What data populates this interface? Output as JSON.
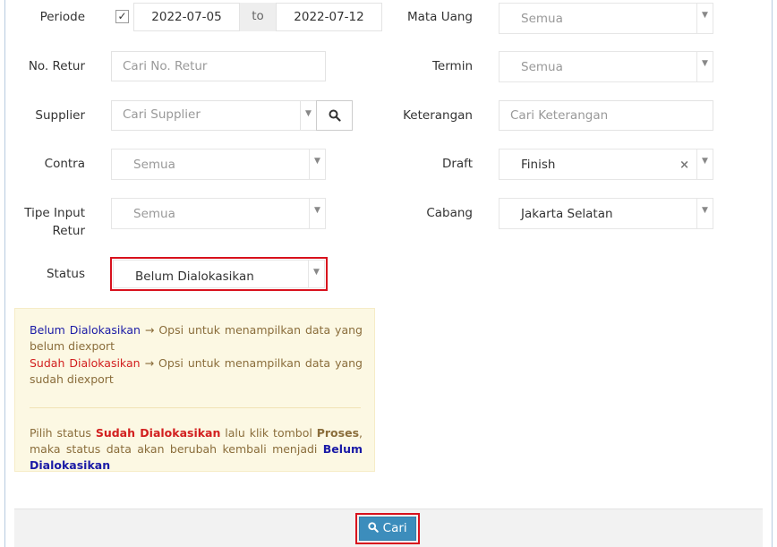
{
  "form": {
    "periode": {
      "label": "Periode",
      "checked": true,
      "from": "2022-07-05",
      "to_label": "to",
      "to": "2022-07-12"
    },
    "no_retur": {
      "label": "No. Retur",
      "placeholder": "Cari No. Retur"
    },
    "supplier": {
      "label": "Supplier",
      "placeholder": "Cari Supplier"
    },
    "contra": {
      "label": "Contra",
      "value": "Semua"
    },
    "tipe_input_retur": {
      "label_line1": "Tipe Input",
      "label_line2": "Retur",
      "value": "Semua"
    },
    "status": {
      "label": "Status",
      "value": "Belum Dialokasikan"
    },
    "mata_uang": {
      "label": "Mata Uang",
      "value": "Semua"
    },
    "termin": {
      "label": "Termin",
      "value": "Semua"
    },
    "keterangan": {
      "label": "Keterangan",
      "placeholder": "Cari Keterangan"
    },
    "draft": {
      "label": "Draft",
      "value": "Finish",
      "clear": "×"
    },
    "cabang": {
      "label": "Cabang",
      "value": "Jakarta Selatan"
    }
  },
  "note": {
    "line1_term": "Belum Dialokasikan",
    "line1_text": " → Opsi untuk menampilkan data yang belum diexport",
    "line2_term": "Sudah Dialokasikan",
    "line2_text": " → Opsi untuk menampilkan data yang sudah diexport",
    "para_a": "Pilih status ",
    "para_b": "Sudah Dialokasikan",
    "para_c": " lalu klik tombol ",
    "para_d": "Proses",
    "para_e": ", maka status data akan berubah kembali menjadi ",
    "para_f": "Belum Dialokasikan"
  },
  "footer": {
    "cari_label": "Cari"
  },
  "colors": {
    "accent": "#3c8dbc",
    "highlight": "#d8111d",
    "note_bg": "#fcf8e3"
  }
}
